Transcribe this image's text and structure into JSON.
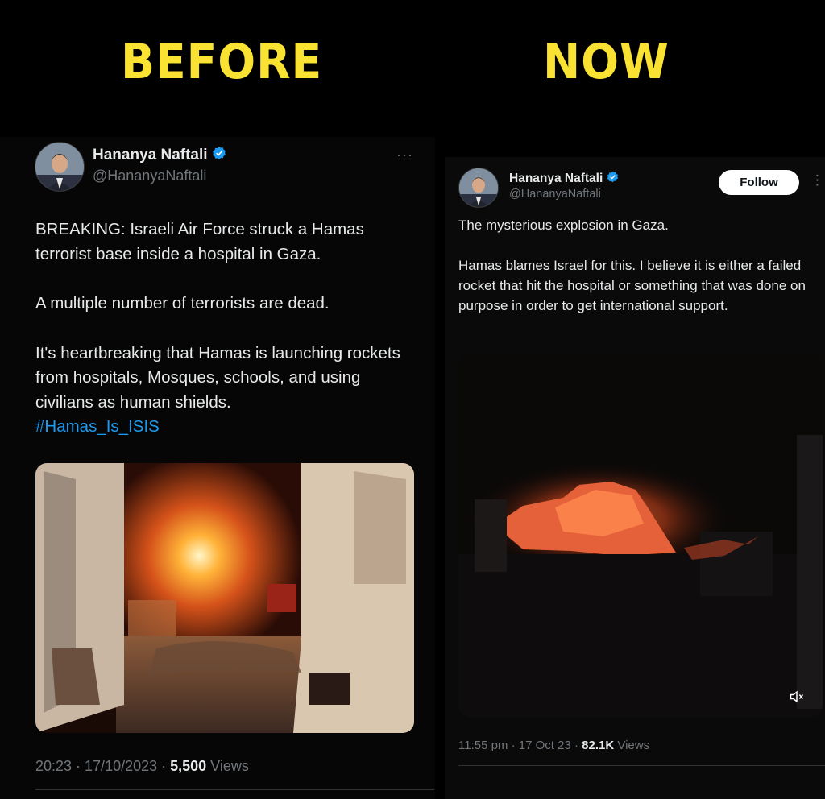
{
  "headings": {
    "before": "BEFORE",
    "now": "NOW"
  },
  "before_tweet": {
    "author_name": "Hananya Naftali",
    "author_handle": "@HananyaNaftali",
    "more_label": "···",
    "paragraph_1": "BREAKING: Israeli Air Force struck a Hamas terrorist base inside a hospital in Gaza.",
    "paragraph_2": "A multiple number of terrorists are dead.",
    "paragraph_3": "It's heartbreaking that Hamas is launching rockets from hospitals, Mosques, schools, and using civilians as human shields.",
    "hashtag": "#Hamas_Is_ISIS",
    "timestamp": "20:23 · 17/10/2023 · ",
    "views_count": "5,500",
    "views_label": " Views"
  },
  "now_tweet": {
    "author_name": "Hananya Naftali",
    "author_handle": "@HananyaNaftali",
    "follow_label": "Follow",
    "more_label": "⋮",
    "paragraph_1": "The mysterious explosion in Gaza.",
    "paragraph_2": "Hamas blames Israel for this. I believe it is either a failed rocket that hit the hospital or something that was done on purpose in order to get international support.",
    "timestamp": "11:55 pm · 17 Oct 23 · ",
    "views_count": "82.1K",
    "views_label": " Views"
  },
  "colors": {
    "heading_yellow": "#f9e232",
    "link_blue": "#1d9bf0",
    "verified_blue": "#1d9bf0",
    "muted_gray": "#71767b"
  },
  "icons": [
    "verified-badge-icon",
    "more-options-icon",
    "mute-icon"
  ]
}
